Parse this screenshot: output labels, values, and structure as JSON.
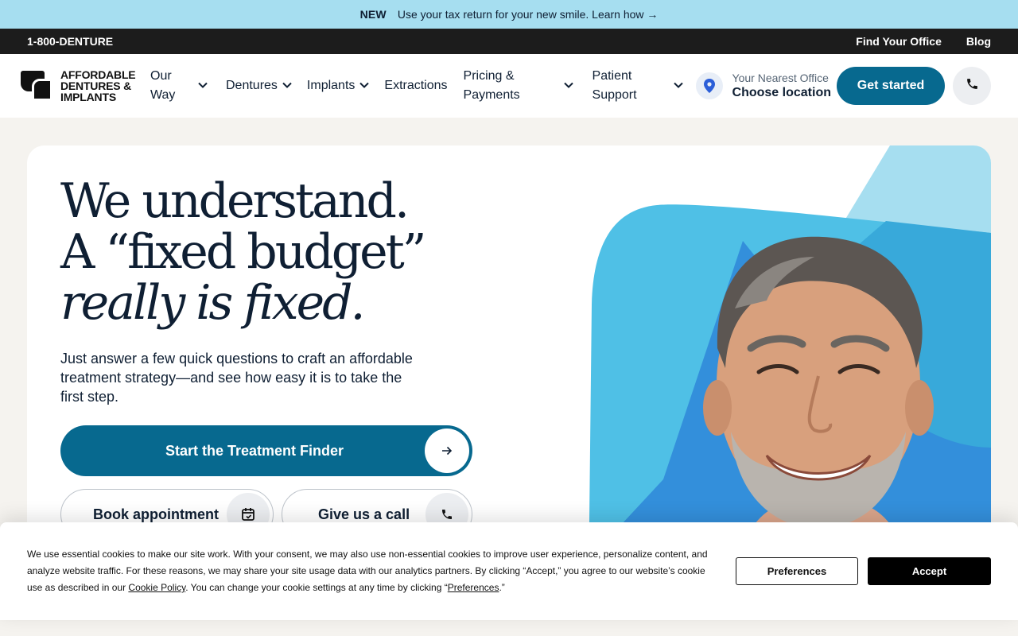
{
  "announcement": {
    "tag": "NEW",
    "text": "Use your tax return for your new smile. Learn how →"
  },
  "utility": {
    "phone": "1-800-DENTURE",
    "links": [
      "Find Your Office",
      "Blog"
    ]
  },
  "logo": {
    "line1": "AFFORDABLE",
    "line2": "DENTURES &",
    "line3": "IMPLANTS"
  },
  "nav": {
    "items": [
      {
        "label": "Our Way",
        "line1": "Our",
        "line2": "Way",
        "dropdown": true
      },
      {
        "label": "Dentures",
        "dropdown": true
      },
      {
        "label": "Implants",
        "dropdown": true
      },
      {
        "label": "Extractions",
        "dropdown": false
      },
      {
        "label": "Pricing & Payments",
        "line1": "Pricing &",
        "line2": "Payments",
        "dropdown": true
      },
      {
        "label": "Patient Support",
        "line1": "Patient",
        "line2": "Support",
        "dropdown": true
      }
    ],
    "location_small": "Your Nearest Office",
    "location_big": "Choose location",
    "cta": "Get started",
    "phone_icon": "phone-icon"
  },
  "hero": {
    "line1": "We understand.",
    "line2": "A “fixed budget”",
    "line3": "really is fixed.",
    "subtitle": "Just answer a few quick questions to craft an affordable treatment strategy—and see how easy it is to take the first step.",
    "primary_cta": "Start the Treatment Finder",
    "book": "Book appointment",
    "call": "Give us a call"
  },
  "cookie": {
    "text_before_link": "We use essential cookies to make our site work. With your consent, we may also use non-essential cookies to improve user experience, personalize content, and analyze website traffic. For these reasons, we may share your site usage data with our analytics partners. By clicking “Accept,” you agree to our website’s cookie use as described in our ",
    "policy_link": "Cookie Policy",
    "text_middle": ". You can change your cookie settings at any time by clicking “",
    "prefs_link": "Preferences",
    "text_end": ".”",
    "preferences_button": "Preferences",
    "accept_button": "Accept"
  },
  "colors": {
    "brand_teal": "#07698f",
    "announcement_bg": "#a6def0",
    "utility_bg": "#1c1c1c",
    "page_bg": "#f5f3ef"
  }
}
